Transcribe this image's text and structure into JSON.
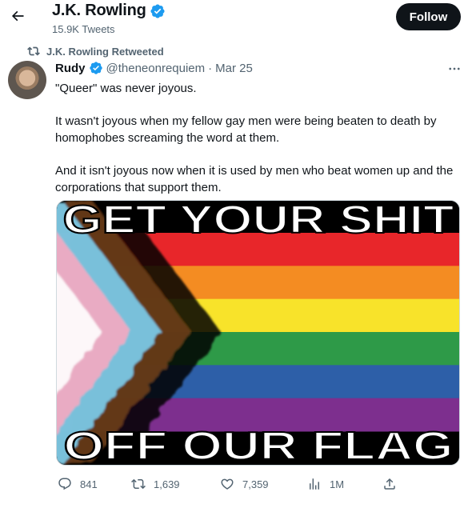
{
  "header": {
    "title": "J.K. Rowling",
    "tweet_count": "15.9K Tweets",
    "follow_label": "Follow"
  },
  "retweet": {
    "label": "J.K. Rowling Retweeted"
  },
  "tweet": {
    "author_name": "Rudy",
    "handle": "@theneonrequiem",
    "separator": "·",
    "date": "Mar 25",
    "paragraphs": [
      "\"Queer\" was never joyous.",
      "It wasn't joyous when my fellow gay men were being beaten to death by homophobes screaming the word at them.",
      "And it isn't joyous now when it is used by men who beat women up and the corporations that support them."
    ],
    "image": {
      "top_text": "GET YOUR SHIT",
      "bottom_text": "OFF OUR FLAG",
      "stripe_colors": [
        "#e8262a",
        "#f48c22",
        "#f8e32a",
        "#2e9a48",
        "#2d5fa8",
        "#7d2f8e"
      ],
      "chevron_colors": [
        "#000000",
        "#6b3e1c",
        "#7ccff0",
        "#f5a9c0",
        "#ffffff"
      ]
    },
    "metrics": {
      "replies": "841",
      "retweets": "1,639",
      "likes": "7,359",
      "views": "1M"
    }
  },
  "icons": {
    "back": "arrow-left-icon",
    "verified": "verified-badge-icon",
    "retweet": "retweet-icon",
    "more": "more-icon",
    "reply": "reply-icon",
    "like": "heart-icon",
    "views": "views-icon",
    "share": "share-icon"
  },
  "colors": {
    "verified": "#1d9bf0",
    "secondary_text": "#536471",
    "follow_button": "#0f1419"
  }
}
